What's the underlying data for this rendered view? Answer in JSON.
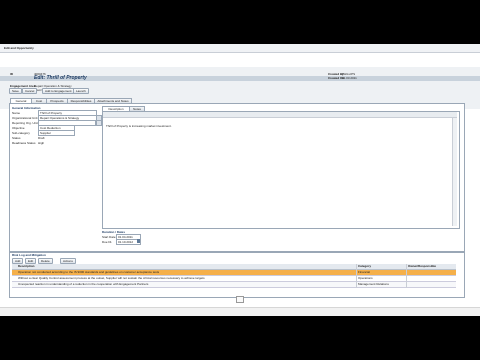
{
  "window": {
    "title": "Edit and Opportunity"
  },
  "header": {
    "id_label": "ID",
    "id_value": "4000476",
    "object_title": "Edit: Thrill of Property",
    "type_label": "Engagement Area",
    "type_value": "Repair Operation & Strategy",
    "status_label": "Work Category",
    "status_value": "Sourcing",
    "created_by_label": "Created By",
    "created_by_value": "PHILLIPS",
    "created_on_label": "Created On",
    "created_on_value": "01.03.2011"
  },
  "toolbar": {
    "save_label": "Save",
    "cancel_label": "Cancel",
    "add_to_project_label": "Add to Engagement",
    "launch_label": "Launch"
  },
  "tabs": [
    {
      "label": "General"
    },
    {
      "label": "Cost"
    },
    {
      "label": "Prospects"
    },
    {
      "label": "Responsibilities"
    },
    {
      "label": "Attachments and Notes"
    }
  ],
  "general_info": {
    "section_title": "General Information",
    "fields": [
      {
        "label": "Name",
        "value": "Thrill of Property"
      },
      {
        "label": "Organizational Unit",
        "value": "Repair Operations & Strategy"
      },
      {
        "label": "Reporting Org. Unit",
        "value": ""
      },
      {
        "label": "Objective",
        "value": "Cost Reduction"
      },
      {
        "label": "Sub-category",
        "value": "Supplier"
      },
      {
        "label": "Status",
        "value": "Draft"
      },
      {
        "label": "Readiness Status",
        "value": "High"
      }
    ]
  },
  "description": {
    "tab1": "Description",
    "tab2": "Notes",
    "text": "Thrill of Property is increasing market investment.",
    "subtitle": ""
  },
  "duration": {
    "section_title": "Duration / Dates",
    "start_label": "Start Date",
    "start_value": "01.04.2011",
    "end_label": "Due Dt.",
    "end_value": "01.10.2012"
  },
  "risk_table": {
    "section_title": "Risk Log and Mitigation",
    "buttons": [
      "Add",
      "Edit",
      "Delete",
      "Actions"
    ],
    "col_description": "Description",
    "col_category": "Category",
    "col_owner": "Owner/Responsible",
    "rows": [
      {
        "text": "Operation not conducted according to the IS 9000 standards and guidelines on customer acceptance tests",
        "category": "Financial",
        "highlight": true
      },
      {
        "text": "Without a clear Quality Control assessment process at the outset, Supplier will not sustain the critical resources necessary to achieve targets",
        "category": "Operations",
        "highlight": false
      },
      {
        "text": "Unexpected reaction in understanding of a reduction in the cooperation with Engagement Partners",
        "category": "Management Relations",
        "highlight": false
      }
    ]
  },
  "colors": {
    "title_bar": "#c8d2dc",
    "highlight_row": "#f5b04a",
    "header_band": "#eef1f4",
    "accent_text": "#1d3b63"
  }
}
